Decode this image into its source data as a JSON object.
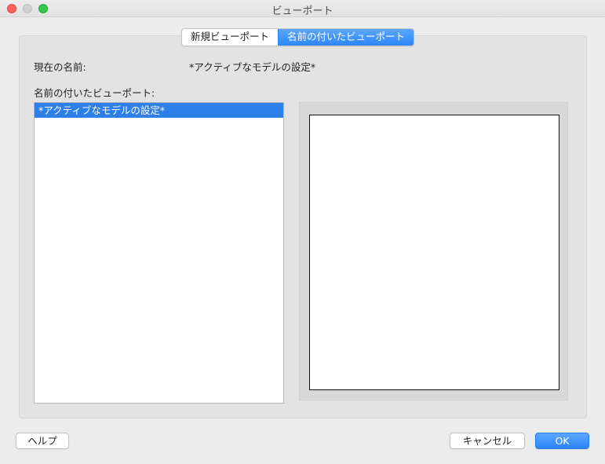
{
  "window": {
    "title": "ビューポート"
  },
  "tabs": [
    {
      "label": "新規ビューポート",
      "active": false
    },
    {
      "label": "名前の付いたビューポート",
      "active": true
    }
  ],
  "current_name": {
    "label": "現在の名前:",
    "value": "*アクティブなモデルの設定*"
  },
  "named_viewports": {
    "label": "名前の付いたビューポート:",
    "items": [
      "*アクティブなモデルの設定*"
    ],
    "selected_index": 0
  },
  "buttons": {
    "help": "ヘルプ",
    "cancel": "キャンセル",
    "ok": "OK"
  },
  "colors": {
    "accent": "#2f86f6",
    "selection": "#2f7fe8",
    "close": "#fc605c",
    "maximize": "#34c84a"
  }
}
